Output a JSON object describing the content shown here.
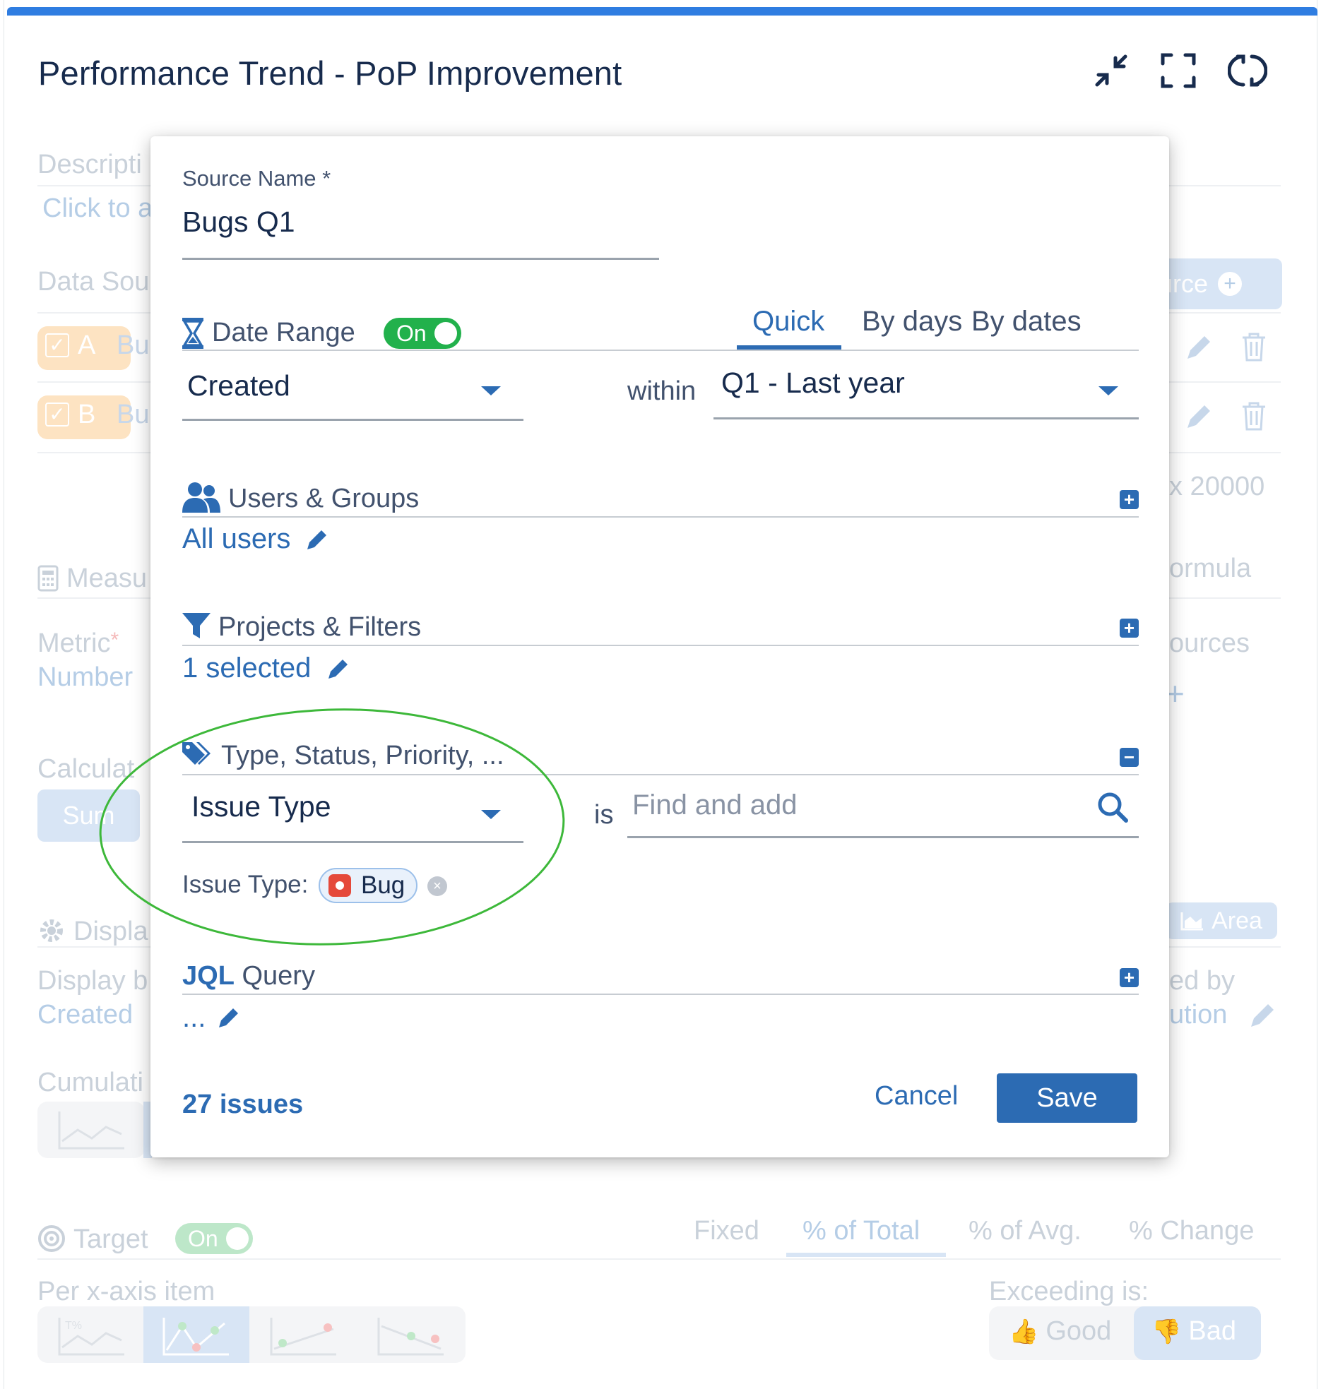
{
  "header": {
    "title": "Performance Trend - PoP Improvement",
    "icons": [
      "collapse-icon",
      "fullscreen-icon",
      "refresh-icon"
    ]
  },
  "background": {
    "description_label": "Descripti",
    "description_link": "Click to a",
    "data_sources_label": "Data Sou",
    "add_source_label": "urce",
    "source_a_letter": "A",
    "source_a_text": "Bu",
    "source_b_letter": "B",
    "source_b_text": "Bu",
    "max_text": "x 20000",
    "measure_label": "Measu",
    "formula_label": "ormula",
    "metric_label": "Metric",
    "metric_required": "*",
    "metric_value": "Number",
    "sources_label": "ources",
    "plus_sign": "+",
    "calculation_label": "Calculat",
    "sum_label": "Sum",
    "display_label": "Displa",
    "area_label": "Area",
    "display_by_label": "Display b",
    "display_by_value": "Created",
    "grouped_by_label": "ed by",
    "grouped_by_value": "ution",
    "cumulative_label": "Cumulati",
    "target_label": "Target",
    "target_toggle": "On",
    "target_tabs": [
      "Fixed",
      "% of Total",
      "% of Avg.",
      "% Change"
    ],
    "per_axis_label": "Per x-axis item",
    "exceeding_label": "Exceeding is:",
    "good_label": "Good",
    "bad_label": "Bad"
  },
  "modal": {
    "source_name_label": "Source Name *",
    "source_name_value": "Bugs Q1",
    "date_range": {
      "label": "Date Range",
      "toggle": "On",
      "tabs": [
        "Quick",
        "By days",
        "By dates"
      ],
      "active_tab": "Quick",
      "field_value": "Created",
      "within_label": "within",
      "period_value": "Q1 - Last year"
    },
    "users_groups": {
      "title": "Users & Groups",
      "value": "All users"
    },
    "projects_filters": {
      "title": "Projects & Filters",
      "value": "1 selected"
    },
    "type_status": {
      "title": "Type, Status, Priority, ...",
      "field_value": "Issue Type",
      "is_label": "is",
      "search_placeholder": "Find and add",
      "selected_label": "Issue Type:",
      "selected_tag": "Bug"
    },
    "jql": {
      "title_bold": "JQL",
      "title_rest": " Query",
      "value": "..."
    },
    "footer": {
      "count": "27 issues",
      "cancel_label": "Cancel",
      "save_label": "Save"
    }
  },
  "colors": {
    "accent": "#2c6bb3",
    "top_bar": "#2f7de1",
    "toggle_on": "#22b14c",
    "highlight_ellipse": "#3db83a",
    "bug": "#e5493a"
  }
}
